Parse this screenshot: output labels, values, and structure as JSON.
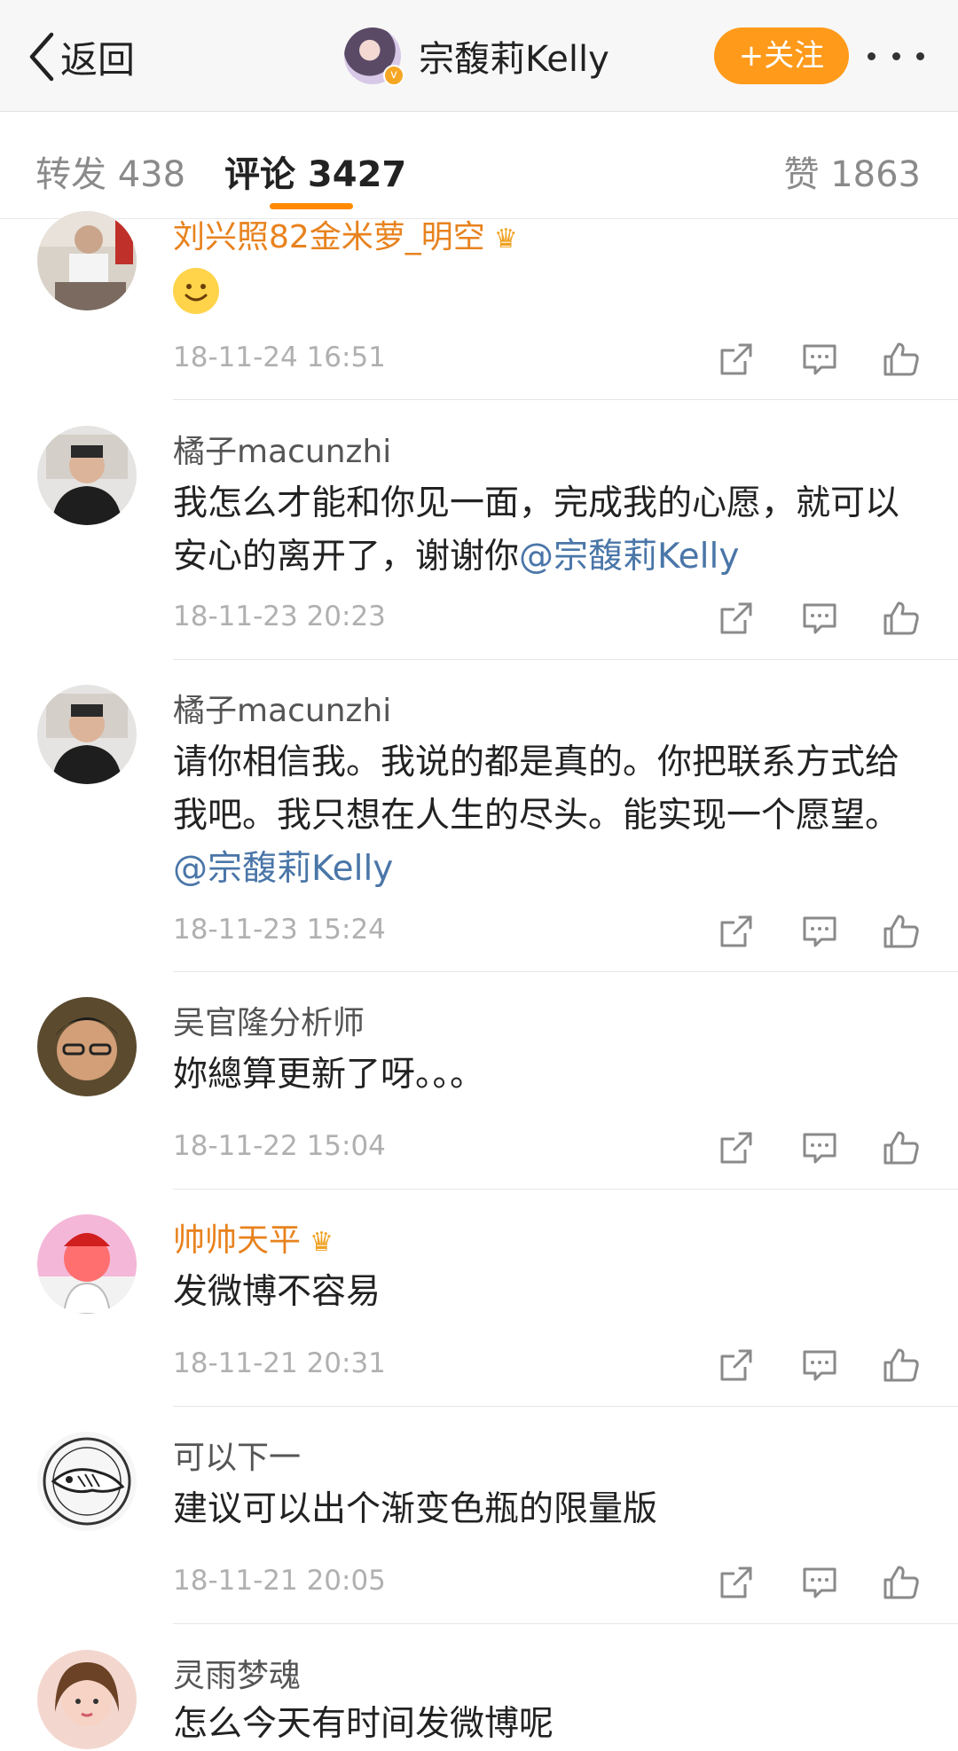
{
  "nav": {
    "back_label": "返回",
    "profile_name": "宗馥莉Kelly",
    "follow_label": "+关注"
  },
  "tabs": [
    {
      "label": "转发 438"
    },
    {
      "label": "评论 3427"
    },
    {
      "label": "赞 1863"
    }
  ],
  "comments": [
    {
      "name": "刘兴照82金米萝_明空",
      "text": "",
      "time": "18-11-24 16:51"
    },
    {
      "name": "橘子macunzhi",
      "text": "我怎么才能和你见一面，完成我的心愿，就可以安心的离开了，谢谢你",
      "mention": "@宗馥莉Kelly",
      "time": "18-11-23 20:23"
    },
    {
      "name": "橘子macunzhi",
      "text": "请你相信我。我说的都是真的。你把联系方式给我吧。我只想在人生的尽头。能实现一个愿望。",
      "mention": "@宗馥莉Kelly",
      "time": "18-11-23 15:24"
    },
    {
      "name": "吴官隆分析师",
      "text": "妳總算更新了呀。。。",
      "time": "18-11-22 15:04"
    },
    {
      "name": "帅帅天平",
      "text": "发微博不容易",
      "time": "18-11-21 20:31"
    },
    {
      "name": "可以下一",
      "text": "建议可以出个渐变色瓶的限量版",
      "time": "18-11-21 20:05"
    },
    {
      "name": "灵雨梦魂",
      "text": "怎么今天有时间发微博呢"
    }
  ]
}
